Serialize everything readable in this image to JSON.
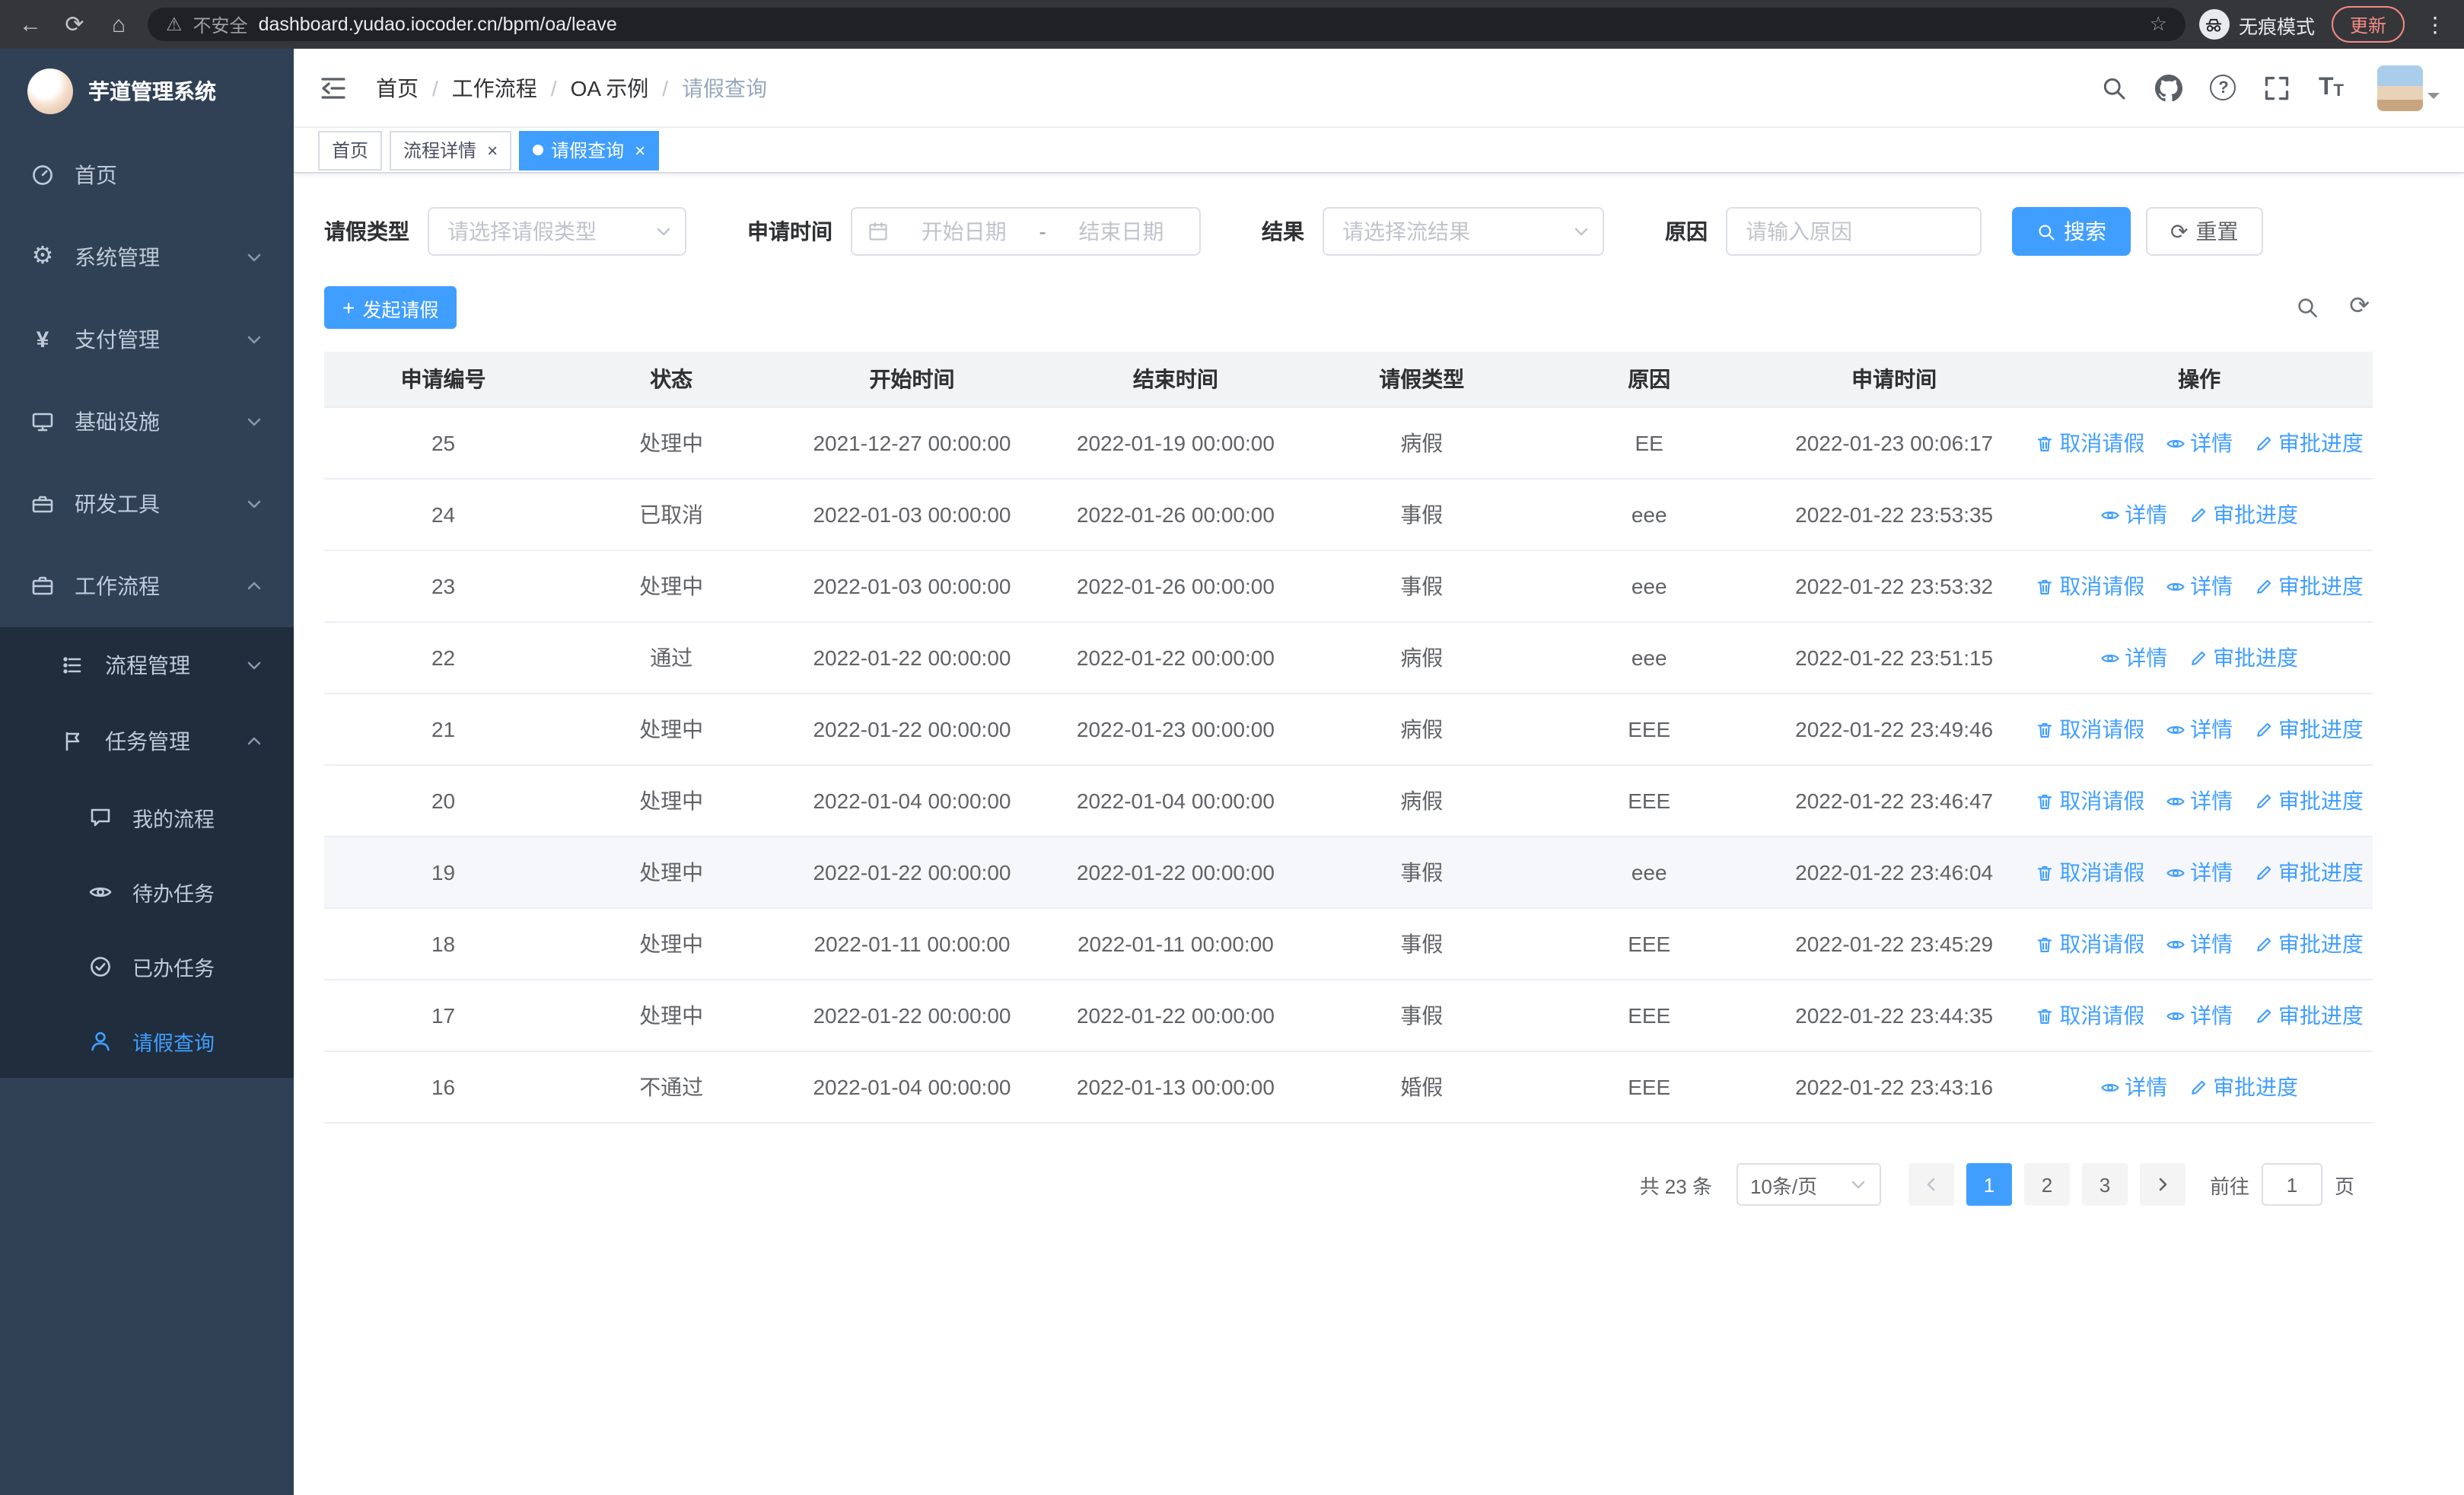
{
  "colors": {
    "primary": "#409eff",
    "sidebar_bg": "#304156",
    "submenu_bg": "#1f2d3d",
    "update_chip": "#f28b82"
  },
  "icons": {
    "back": "←",
    "reload": "⟳",
    "home": "⌂",
    "warning": "⚠",
    "star": "☆",
    "menu_dots": "⋮",
    "close": "×",
    "plus": "+",
    "refresh": "⟳",
    "question": "?",
    "gear": "⚙",
    "yen": "¥",
    "font_large": "T",
    "font_small": "T",
    "breadcrumb_separator": "/"
  },
  "browser": {
    "security_warning": "不安全",
    "url": "dashboard.yudao.iocoder.cn/bpm/oa/leave",
    "incognito_label": "无痕模式",
    "update_label": "更新"
  },
  "sidebar": {
    "logo_title": "芋道管理系统",
    "items": [
      {
        "label": "首页"
      },
      {
        "label": "系统管理"
      },
      {
        "label": "支付管理"
      },
      {
        "label": "基础设施"
      },
      {
        "label": "研发工具"
      },
      {
        "label": "工作流程"
      }
    ],
    "sub_items": [
      {
        "label": "流程管理"
      },
      {
        "label": "任务管理"
      }
    ],
    "leaf_items": [
      {
        "label": "我的流程"
      },
      {
        "label": "待办任务"
      },
      {
        "label": "已办任务"
      },
      {
        "label": "请假查询"
      }
    ]
  },
  "header": {
    "breadcrumb": [
      "首页",
      "工作流程",
      "OA 示例",
      "请假查询"
    ]
  },
  "tabs": [
    {
      "label": "首页"
    },
    {
      "label": "流程详情"
    },
    {
      "label": "请假查询"
    }
  ],
  "filters": {
    "leave_type_label": "请假类型",
    "leave_type_placeholder": "请选择请假类型",
    "apply_time_label": "申请时间",
    "start_date_placeholder": "开始日期",
    "date_separator": "-",
    "end_date_placeholder": "结束日期",
    "result_label": "结果",
    "result_placeholder": "请选择流结果",
    "reason_label": "原因",
    "reason_placeholder": "请输入原因",
    "search_label": "搜索",
    "reset_label": "重置"
  },
  "toolbar": {
    "create_label": "发起请假"
  },
  "table": {
    "columns": [
      "申请编号",
      "状态",
      "开始时间",
      "结束时间",
      "请假类型",
      "原因",
      "申请时间",
      "操作"
    ],
    "action_labels": {
      "cancel": "取消请假",
      "detail": "详情",
      "progress": "审批进度"
    },
    "rows": [
      {
        "id": "25",
        "status": "处理中",
        "start": "2021-12-27 00:00:00",
        "end": "2022-01-19 00:00:00",
        "type": "病假",
        "reason": "EE",
        "apply_time": "2022-01-23 00:06:17",
        "can_cancel": true,
        "highlighted": false
      },
      {
        "id": "24",
        "status": "已取消",
        "start": "2022-01-03 00:00:00",
        "end": "2022-01-26 00:00:00",
        "type": "事假",
        "reason": "eee",
        "apply_time": "2022-01-22 23:53:35",
        "can_cancel": false,
        "highlighted": false
      },
      {
        "id": "23",
        "status": "处理中",
        "start": "2022-01-03 00:00:00",
        "end": "2022-01-26 00:00:00",
        "type": "事假",
        "reason": "eee",
        "apply_time": "2022-01-22 23:53:32",
        "can_cancel": true,
        "highlighted": false
      },
      {
        "id": "22",
        "status": "通过",
        "start": "2022-01-22 00:00:00",
        "end": "2022-01-22 00:00:00",
        "type": "病假",
        "reason": "eee",
        "apply_time": "2022-01-22 23:51:15",
        "can_cancel": false,
        "highlighted": false
      },
      {
        "id": "21",
        "status": "处理中",
        "start": "2022-01-22 00:00:00",
        "end": "2022-01-23 00:00:00",
        "type": "病假",
        "reason": "EEE",
        "apply_time": "2022-01-22 23:49:46",
        "can_cancel": true,
        "highlighted": false
      },
      {
        "id": "20",
        "status": "处理中",
        "start": "2022-01-04 00:00:00",
        "end": "2022-01-04 00:00:00",
        "type": "病假",
        "reason": "EEE",
        "apply_time": "2022-01-22 23:46:47",
        "can_cancel": true,
        "highlighted": false
      },
      {
        "id": "19",
        "status": "处理中",
        "start": "2022-01-22 00:00:00",
        "end": "2022-01-22 00:00:00",
        "type": "事假",
        "reason": "eee",
        "apply_time": "2022-01-22 23:46:04",
        "can_cancel": true,
        "highlighted": true
      },
      {
        "id": "18",
        "status": "处理中",
        "start": "2022-01-11 00:00:00",
        "end": "2022-01-11 00:00:00",
        "type": "事假",
        "reason": "EEE",
        "apply_time": "2022-01-22 23:45:29",
        "can_cancel": true,
        "highlighted": false
      },
      {
        "id": "17",
        "status": "处理中",
        "start": "2022-01-22 00:00:00",
        "end": "2022-01-22 00:00:00",
        "type": "事假",
        "reason": "EEE",
        "apply_time": "2022-01-22 23:44:35",
        "can_cancel": true,
        "highlighted": false
      },
      {
        "id": "16",
        "status": "不通过",
        "start": "2022-01-04 00:00:00",
        "end": "2022-01-13 00:00:00",
        "type": "婚假",
        "reason": "EEE",
        "apply_time": "2022-01-22 23:43:16",
        "can_cancel": false,
        "highlighted": false
      }
    ]
  },
  "pagination": {
    "total_text": "共 23 条",
    "page_size": "10条/页",
    "pages": [
      "1",
      "2",
      "3"
    ],
    "active_page": "1",
    "goto_label": "前往",
    "goto_value": "1",
    "page_label": "页"
  }
}
